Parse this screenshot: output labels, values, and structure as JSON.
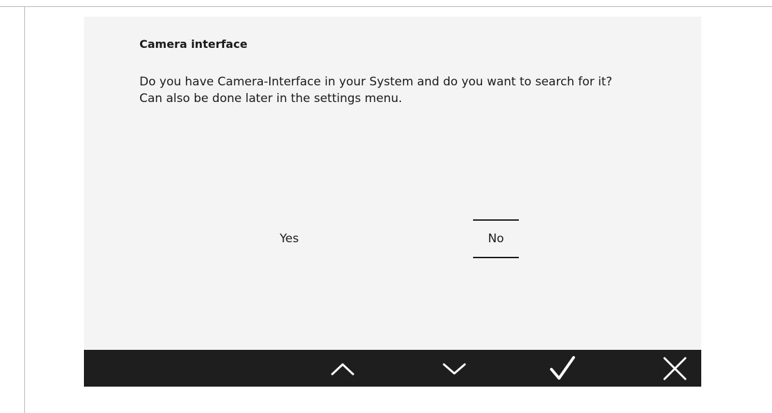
{
  "dialog": {
    "title": "Camera interface",
    "message_line1": "Do you have Camera-Interface in your System and do you want to search for it?",
    "message_line2": "Can also be done later in the settings menu."
  },
  "options": {
    "yes_label": "Yes",
    "no_label": "No",
    "selected": "No"
  },
  "toolbar": {
    "buttons": [
      {
        "icon": "chevron-up-icon"
      },
      {
        "icon": "chevron-down-icon"
      },
      {
        "icon": "checkmark-icon"
      },
      {
        "icon": "close-icon"
      }
    ]
  },
  "colors": {
    "screen_background": "#f4f4f4",
    "toolbar_background": "#1e1e1e",
    "text": "#1a1a1a",
    "icon": "#ffffff"
  }
}
